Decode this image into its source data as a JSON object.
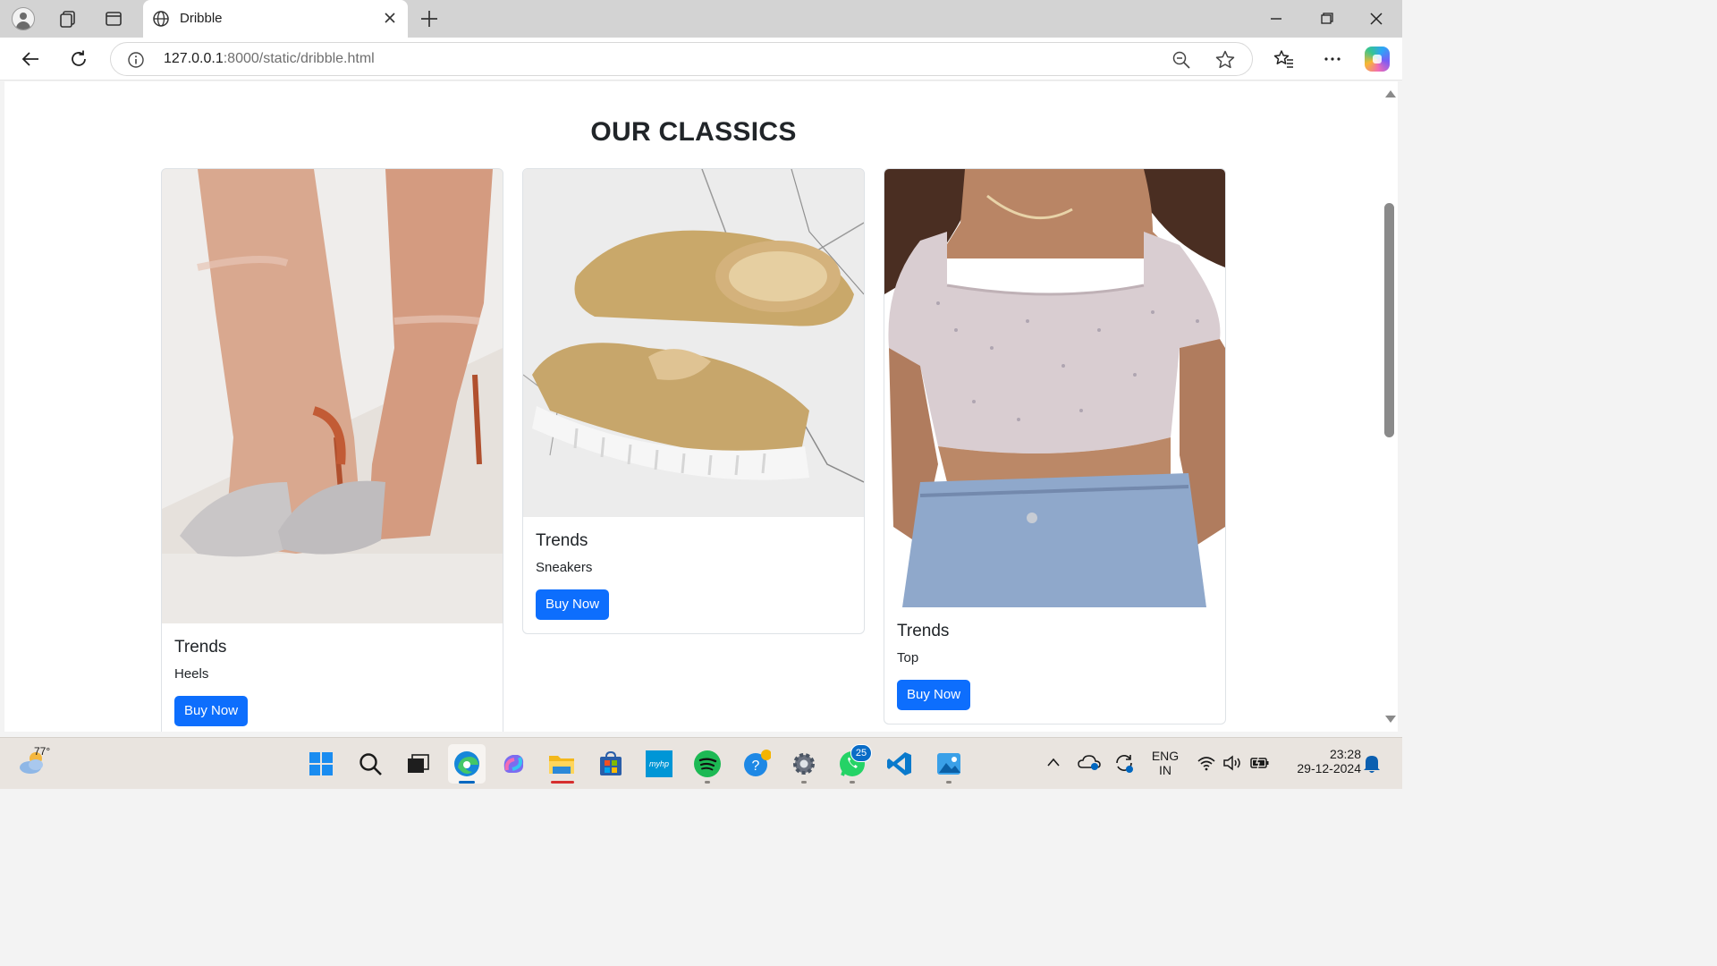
{
  "browser": {
    "tab_title": "Dribble",
    "url_host": "127.0.0.1",
    "url_rest": ":8000/static/dribble.html"
  },
  "page": {
    "heading": "OUR CLASSICS",
    "cards": [
      {
        "title": "Trends",
        "text": "Heels",
        "button": "Buy Now",
        "image": "heels-photo"
      },
      {
        "title": "Trends",
        "text": "Sneakers",
        "button": "Buy Now",
        "image": "sneakers-photo"
      },
      {
        "title": "Trends",
        "text": "Top",
        "button": "Buy Now",
        "image": "top-photo"
      }
    ]
  },
  "taskbar": {
    "weather_temp": "77°",
    "whatsapp_badge": "25",
    "lang_top": "ENG",
    "lang_bottom": "IN",
    "time": "23:28",
    "date": "29-12-2024",
    "myhp_label": "myhp"
  },
  "colors": {
    "accent": "#0d6efd",
    "tabstrip": "#d3d3d3",
    "taskbar": "#e9e4df"
  }
}
